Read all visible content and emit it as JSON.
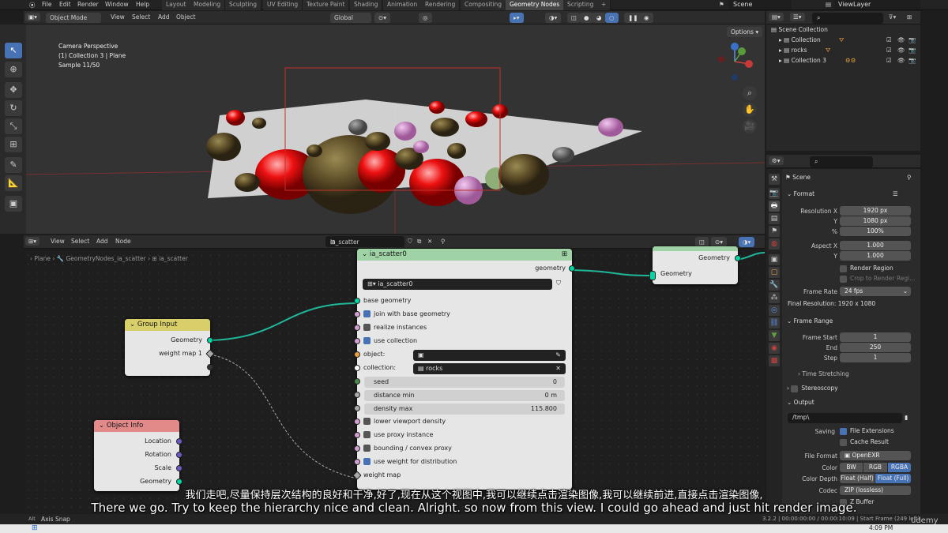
{
  "topbar": {
    "menus": [
      "File",
      "Edit",
      "Render",
      "Window",
      "Help"
    ],
    "workspaces": [
      "Layout",
      "Modeling",
      "Sculpting",
      "UV Editing",
      "Texture Paint",
      "Shading",
      "Animation",
      "Rendering",
      "Compositing",
      "Geometry Nodes",
      "Scripting",
      "+"
    ],
    "active_workspace": "Geometry Nodes",
    "scene": "Scene",
    "view_layer": "ViewLayer"
  },
  "viewport_header": {
    "mode": "Object Mode",
    "menus": [
      "View",
      "Select",
      "Add",
      "Object"
    ],
    "orientation": "Global",
    "options": "Options"
  },
  "viewport": {
    "info_line1": "Camera Perspective",
    "info_line2": "(1) Collection 3 | Plane",
    "info_line3": "Sample 11/50"
  },
  "node_editor_header": {
    "menus": [
      "View",
      "Select",
      "Add",
      "Node"
    ],
    "node_tree": "ia_scatter"
  },
  "breadcrumb": [
    "Plane",
    "GeometryNodes_ia_scatter",
    "ia_scatter"
  ],
  "nodes": {
    "group_input": {
      "title": "Group Input",
      "outputs": [
        "Geometry",
        "weight map 1"
      ]
    },
    "object_info": {
      "title": "Object Info",
      "outputs": [
        "Location",
        "Rotation",
        "Scale",
        "Geometry"
      ]
    },
    "group_output": {
      "output": "Geometry",
      "input": "Geometry"
    },
    "ia_scatter": {
      "title": "ia_scatter0",
      "output": "geometry",
      "datablock": "ia_scatter0",
      "base_geometry": "base geometry",
      "join": "join with base geometry",
      "realize": "realize instances",
      "use_collection": "use collection",
      "object_label": "object:",
      "collection_label": "collection:",
      "collection_value": "rocks",
      "seed_label": "seed",
      "seed_value": "0",
      "dist_label": "distance min",
      "dist_value": "0 m",
      "density_label": "density max",
      "density_value": "115.800",
      "lower_density": "lower viewport density",
      "proxy": "use proxy instance",
      "bounding": "bounding / convex proxy",
      "use_weight": "use weight for distribution",
      "weight_map": "weight map"
    }
  },
  "outliner": {
    "root": "Scene Collection",
    "items": [
      "Collection",
      "rocks",
      "Collection 3"
    ]
  },
  "properties": {
    "context": "Scene",
    "format_section": "Format",
    "res_x_label": "Resolution X",
    "res_x": "1920 px",
    "res_y_label": "Y",
    "res_y": "1080 px",
    "pct_label": "%",
    "pct": "100%",
    "aspect_x_label": "Aspect X",
    "aspect_x": "1.000",
    "aspect_y_label": "Y",
    "aspect_y": "1.000",
    "render_region": "Render Region",
    "crop": "Crop to Render Regi...",
    "frame_rate_label": "Frame Rate",
    "frame_rate": "24 fps",
    "final_res": "Final Resolution: 1920 x 1080",
    "frame_range_section": "Frame Range",
    "frame_start_label": "Frame Start",
    "frame_start": "1",
    "end_label": "End",
    "end": "250",
    "step_label": "Step",
    "step": "1",
    "time_stretching": "Time Stretching",
    "stereoscopy": "Stereoscopy",
    "output_section": "Output",
    "output_path": "/tmp\\",
    "saving_label": "Saving",
    "file_ext": "File Extensions",
    "cache_result": "Cache Result",
    "file_format_label": "File Format",
    "file_format": "OpenEXR",
    "color_label": "Color",
    "color_opts": [
      "BW",
      "RGB",
      "RGBA"
    ],
    "depth_label": "Color Depth",
    "depth_opts": [
      "Float (Half)",
      "Float (Full)"
    ],
    "codec_label": "Codec",
    "codec": "ZIP (lossless)",
    "zbuffer": "Z Buffer"
  },
  "status": {
    "axis_snap": "Axis Snap",
    "right": "3.2.2 | 00:00:00:00 / 00:00:10:09 | Start Frame (249 left)",
    "time": "4:09 PM",
    "watermark": "udemy"
  },
  "subtitles": {
    "zh": "我们走吧,尽量保持层次结构的良好和干净,好了,现在从这个视图中,我可以继续点击渲染图像,我可以继续前进,直接点击渲染图像,",
    "en": "There we go. Try to keep the hierarchy nice and clean. Alright. so now from this view. I could go ahead and just hit render image."
  },
  "colors": {
    "accent": "#4772b3",
    "group_input_header": "#d8cf6a",
    "object_info_header": "#e28a8a",
    "scatter_header": "#9fd2a5",
    "geometry_socket": "#00d6a3",
    "link": "#20b89a"
  }
}
